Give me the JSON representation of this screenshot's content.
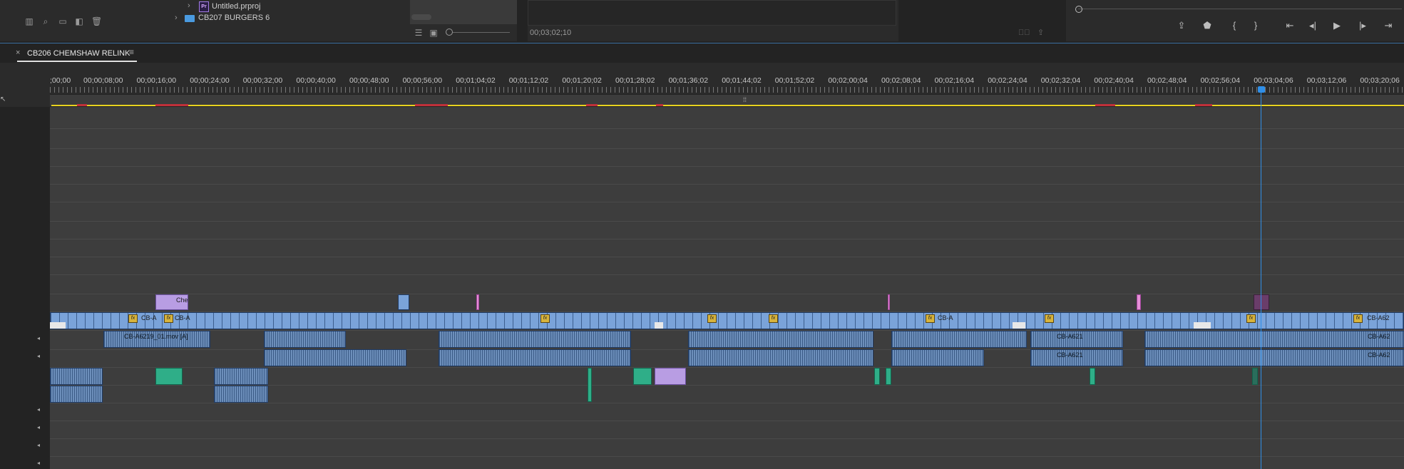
{
  "project_panel": {
    "items": [
      {
        "label": "Untitled.prproj",
        "type": "premiere-project"
      },
      {
        "label": "CB207 BURGERS 6",
        "type": "folder"
      }
    ],
    "toolbar_icons": [
      "list-view-icon",
      "search-icon",
      "folder-icon",
      "new-item-icon",
      "trash-icon"
    ],
    "bottom_icons": [
      "list-view-icon",
      "icon-view-icon",
      "zoom-slider"
    ]
  },
  "source_monitor": {
    "timecode": "00;03;02;10"
  },
  "program_monitor": {
    "transport_icons": [
      "export-frame-icon",
      "add-marker-icon",
      "mark-in-icon",
      "mark-out-icon",
      "go-to-in-icon",
      "step-back-icon",
      "play-icon",
      "step-forward-icon",
      "go-to-out-icon"
    ]
  },
  "sequence": {
    "tab_label": "CB206 CHEMSHAW RELINK",
    "close_glyph": "×",
    "menu_glyph": "≡"
  },
  "ruler": {
    "labels": [
      ";00;00",
      "00;00;08;00",
      "00;00;16;00",
      "00;00;24;00",
      "00;00;32;00",
      "00;00;40;00",
      "00;00;48;00",
      "00;00;56;00",
      "00;01;04;02",
      "00;01;12;02",
      "00;01;20;02",
      "00;01;28;02",
      "00;01;36;02",
      "00;01;44;02",
      "00;01;52;02",
      "00;02;00;04",
      "00;02;08;04",
      "00;02;16;04",
      "00;02;24;04",
      "00;02;32;04",
      "00;02;40;04",
      "00;02;48;04",
      "00;02;56;04",
      "00;03;04;06",
      "00;03;12;06",
      "00;03;20;06"
    ]
  },
  "clips": {
    "v2_label": "Chen",
    "v1_labels": [
      "CB-A",
      "CB-A",
      "CB-A",
      "CB-A62"
    ],
    "a1_labels": [
      "CB-A6219_01.mov [A]",
      "CB-A621",
      "CB-A62"
    ],
    "a2_labels": [
      "CB-A621",
      "CB-A62"
    ]
  },
  "colors": {
    "video_clip": "#7aa3d9",
    "audio_clip": "#5c7fa8",
    "graphic_clip": "#2fae88",
    "title_clip": "#b89de3",
    "playhead": "#2f8fe8",
    "work_area_bar": "#e8d21f"
  }
}
